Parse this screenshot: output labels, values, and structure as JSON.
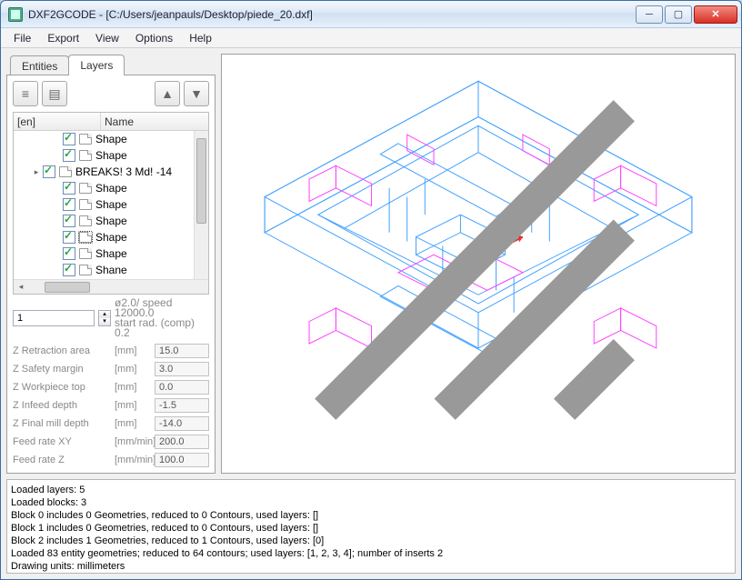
{
  "window": {
    "title": "DXF2GCODE - [C:/Users/jeanpauls/Desktop/piede_20.dxf]"
  },
  "menu": {
    "file": "File",
    "export": "Export",
    "view": "View",
    "options": "Options",
    "help": "Help"
  },
  "tabs": {
    "entities": "Entities",
    "layers": "Layers"
  },
  "tree": {
    "header_en": "[en]",
    "header_name": "Name",
    "rows": [
      {
        "indent": 1,
        "checked": true,
        "name": "Shape"
      },
      {
        "indent": 1,
        "checked": true,
        "name": "Shape"
      },
      {
        "indent": 0,
        "expand": "▸",
        "checked": true,
        "name": "BREAKS! 3 Md! -14"
      },
      {
        "indent": 1,
        "checked": true,
        "name": "Shape"
      },
      {
        "indent": 1,
        "checked": true,
        "name": "Shape"
      },
      {
        "indent": 1,
        "checked": true,
        "name": "Shape"
      },
      {
        "indent": 1,
        "checked": true,
        "name": "Shape",
        "sel": true
      },
      {
        "indent": 1,
        "checked": true,
        "name": "Shape"
      },
      {
        "indent": 1,
        "checked": true,
        "name": "Shane"
      }
    ]
  },
  "spin": {
    "value": "1",
    "hint1": "ø2.0/ speed 12000.0",
    "hint2": "start rad. (comp) 0.2"
  },
  "params": [
    {
      "label": "Z Retraction area",
      "unit": "[mm]",
      "value": "15.0"
    },
    {
      "label": "Z Safety margin",
      "unit": "[mm]",
      "value": "3.0"
    },
    {
      "label": "Z Workpiece top",
      "unit": "[mm]",
      "value": "0.0"
    },
    {
      "label": "Z Infeed depth",
      "unit": "[mm]",
      "value": "-1.5"
    },
    {
      "label": "Z Final mill depth",
      "unit": "[mm]",
      "value": "-14.0"
    },
    {
      "label": "Feed rate XY",
      "unit": "[mm/min]",
      "value": "200.0"
    },
    {
      "label": "Feed rate Z",
      "unit": "[mm/min]",
      "value": "100.0"
    }
  ],
  "log": [
    "Loaded layers: 5",
    "Loaded blocks: 3",
    "Block 0 includes 0 Geometries, reduced to 0 Contours, used layers: []",
    "Block 1 includes 0 Geometries, reduced to 0 Contours, used layers: []",
    "Block 2 includes 1 Geometries, reduced to 1 Contours, used layers: [0]",
    "Loaded 83 entity geometries; reduced to 64 contours; used layers: [1, 2, 3, 4]; number of inserts 2",
    "Drawing units: millimeters"
  ]
}
